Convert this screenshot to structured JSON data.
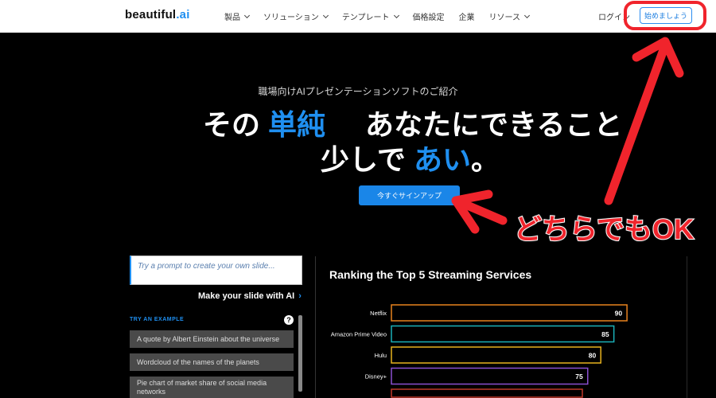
{
  "header": {
    "logo_text": "beautiful",
    "logo_suffix": ".ai",
    "nav": [
      {
        "label": "製品"
      },
      {
        "label": "ソリューション"
      },
      {
        "label": "テンプレート"
      },
      {
        "label": "価格設定"
      },
      {
        "label": "企業"
      },
      {
        "label": "リソース"
      }
    ],
    "login_label": "ログイン",
    "start_button": "始めましょう"
  },
  "hero": {
    "subtitle": "職場向けAIプレゼンテーションソフトのご紹介",
    "line1_pre": "その",
    "line1_accent": "単純",
    "line1_post": "あなたにできること",
    "line2_pre": "少しで",
    "line2_accent": "あい",
    "line2_post": "。",
    "signup_button": "今すぐサインアップ"
  },
  "annotation": {
    "text": "どちらでもOK",
    "color": "#f0242c"
  },
  "left_panel": {
    "prompt_placeholder": "Try a prompt to create your own slide...",
    "make_slide_label": "Make your slide with AI",
    "make_slide_arrow": "›",
    "try_label": "TRY AN EXAMPLE",
    "help_icon": "?",
    "examples": [
      "A quote by Albert Einstein about the universe",
      "Wordcloud of the names of the planets",
      "Pie chart of market share of social media networks"
    ]
  },
  "chart_data": {
    "type": "bar",
    "title": "Ranking the Top 5 Streaming Services",
    "categories": [
      "Netflix",
      "Amazon Prime Video",
      "Hulu",
      "Disney+"
    ],
    "values": [
      90,
      85,
      80,
      75
    ],
    "colors": [
      "#e8821e",
      "#1ab0b8",
      "#e8b21e",
      "#8a4fd0"
    ],
    "xlim": [
      0,
      100
    ]
  },
  "colors": {
    "accent": "#1f8ff0",
    "annotation_red": "#f0242c"
  }
}
